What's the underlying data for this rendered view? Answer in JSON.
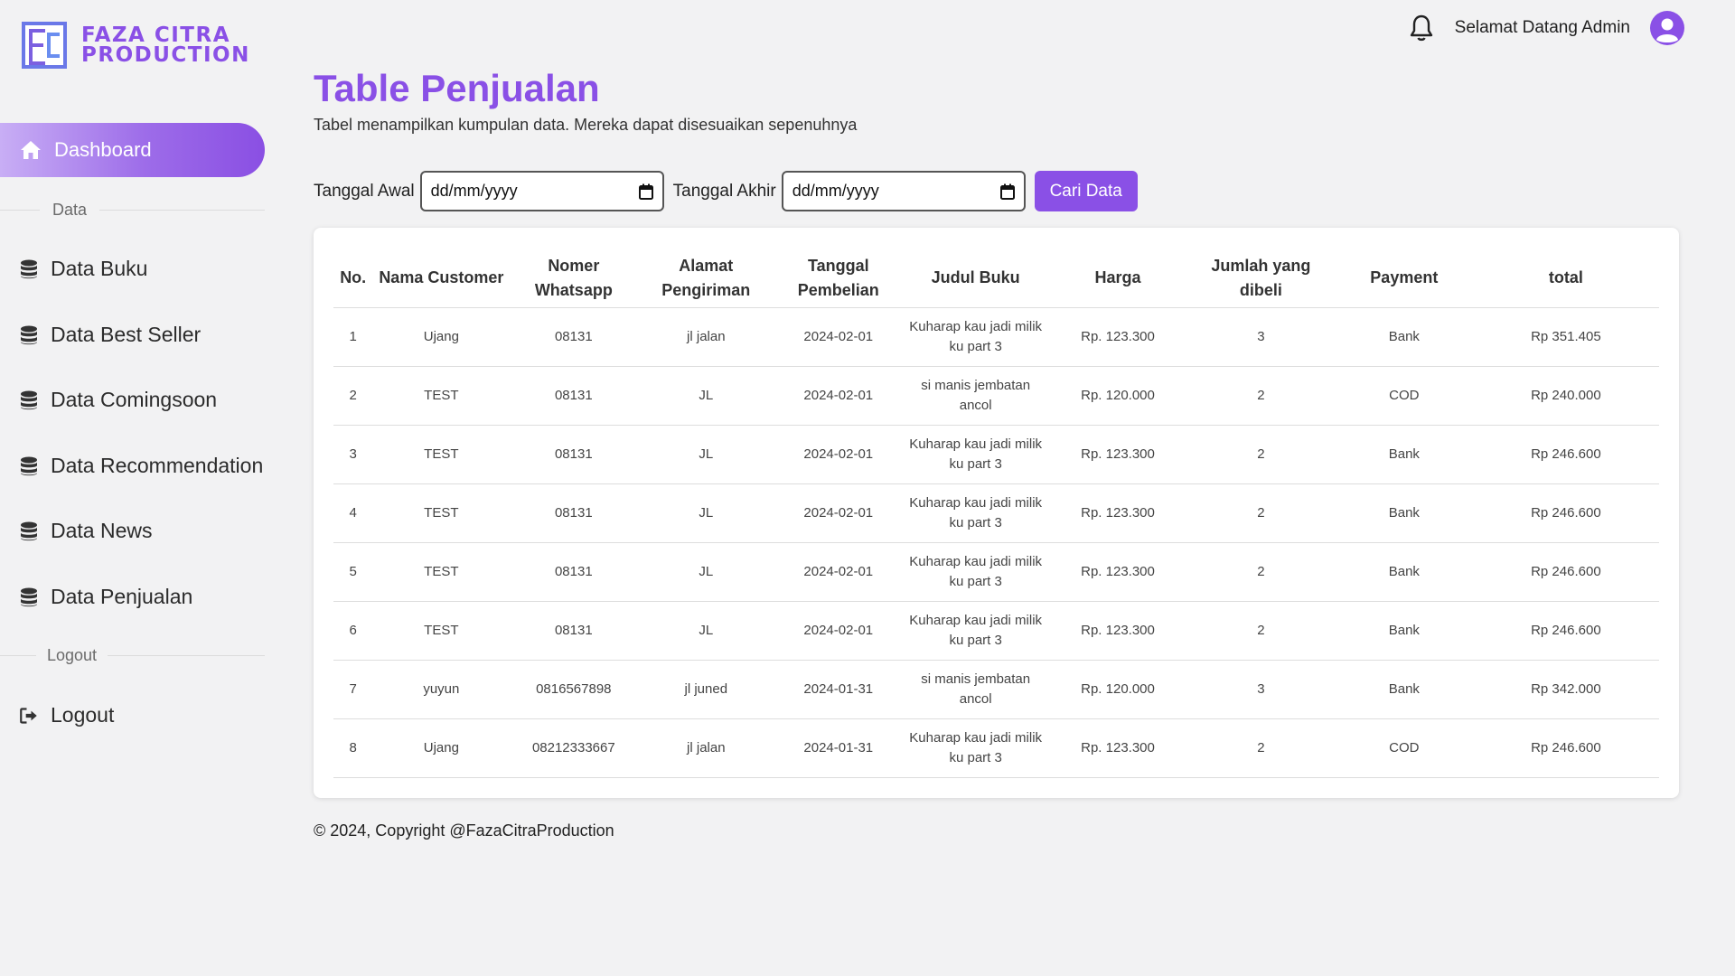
{
  "brand": {
    "line1": "FAZA CITRA",
    "line2": "PRODUCTION",
    "accent": "#8a50e6"
  },
  "sidebar": {
    "active_item": {
      "label": "Dashboard",
      "icon": "home-icon"
    },
    "section_data": "Data",
    "items": [
      {
        "label": "Data Buku",
        "icon": "database-icon"
      },
      {
        "label": "Data Best Seller",
        "icon": "database-icon"
      },
      {
        "label": "Data Comingsoon",
        "icon": "database-icon"
      },
      {
        "label": "Data Recommendation",
        "icon": "database-icon"
      },
      {
        "label": "Data News",
        "icon": "database-icon"
      },
      {
        "label": "Data Penjualan",
        "icon": "database-icon"
      }
    ],
    "section_logout": "Logout",
    "logout_label": "Logout"
  },
  "header": {
    "welcome": "Selamat Datang Admin",
    "bell_icon": "bell-icon",
    "avatar_icon": "user-avatar-icon"
  },
  "main": {
    "title": "Table Penjualan",
    "subtitle": "Tabel menampilkan kumpulan data. Mereka dapat disesuaikan sepenuhnya",
    "filters": {
      "start_label": "Tanggal Awal",
      "start_value": "dd/mm/yyyy",
      "end_label": "Tanggal Akhir",
      "end_value": "dd/mm/yyyy",
      "search_button": "Cari Data"
    },
    "table": {
      "columns": [
        "No.",
        "Nama Customer",
        "Nomer Whatsapp",
        "Alamat Pengiriman",
        "Tanggal Pembelian",
        "Judul Buku",
        "Harga",
        "Jumlah yang dibeli",
        "Payment",
        "total"
      ],
      "rows": [
        [
          "1",
          "Ujang",
          "08131",
          "jl jalan",
          "2024-02-01",
          "Kuharap kau jadi milik ku part 3",
          "Rp. 123.300",
          "3",
          "Bank",
          "Rp 351.405"
        ],
        [
          "2",
          "TEST",
          "08131",
          "JL",
          "2024-02-01",
          "si manis jembatan ancol",
          "Rp. 120.000",
          "2",
          "COD",
          "Rp 240.000"
        ],
        [
          "3",
          "TEST",
          "08131",
          "JL",
          "2024-02-01",
          "Kuharap kau jadi milik ku part 3",
          "Rp. 123.300",
          "2",
          "Bank",
          "Rp 246.600"
        ],
        [
          "4",
          "TEST",
          "08131",
          "JL",
          "2024-02-01",
          "Kuharap kau jadi milik ku part 3",
          "Rp. 123.300",
          "2",
          "Bank",
          "Rp 246.600"
        ],
        [
          "5",
          "TEST",
          "08131",
          "JL",
          "2024-02-01",
          "Kuharap kau jadi milik ku part 3",
          "Rp. 123.300",
          "2",
          "Bank",
          "Rp 246.600"
        ],
        [
          "6",
          "TEST",
          "08131",
          "JL",
          "2024-02-01",
          "Kuharap kau jadi milik ku part 3",
          "Rp. 123.300",
          "2",
          "Bank",
          "Rp 246.600"
        ],
        [
          "7",
          "yuyun",
          "0816567898",
          "jl juned",
          "2024-01-31",
          "si manis jembatan ancol",
          "Rp. 120.000",
          "3",
          "Bank",
          "Rp 342.000"
        ],
        [
          "8",
          "Ujang",
          "08212333667",
          "jl jalan",
          "2024-01-31",
          "Kuharap kau jadi milik ku part 3",
          "Rp. 123.300",
          "2",
          "COD",
          "Rp 246.600"
        ]
      ]
    }
  },
  "footer": {
    "text": "© 2024, Copyright @FazaCitraProduction"
  }
}
